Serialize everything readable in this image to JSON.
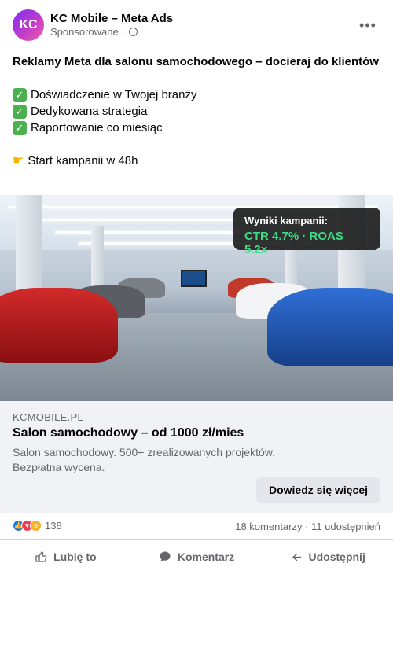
{
  "post": {
    "avatar_initials": "KC",
    "page_name": "KC Mobile – Meta Ads",
    "sponsored": "Sponsorowane ·",
    "more_icon": "ellipsis-icon",
    "title": "Reklamy Meta dla salonu samochodowego – docieraj do klientów",
    "bullets": [
      "Doświadczenie w Twojej branży",
      "Dedykowana strategia",
      "Raportowanie co miesiąc"
    ],
    "cta_line": "Start kampanii w 48h"
  },
  "hero": {
    "results_label": "Wyniki kampanii:",
    "results_value": "CTR 4.7% · ROAS 5.2x"
  },
  "link_card": {
    "domain": "KCMOBILE.PL",
    "headline": "Salon samochodowy – od 1000 zł/mies",
    "description": "Salon samochodowy. 500+ zrealizowanych projektów. Bezpłatna wycena.",
    "button_label": "Dowiedz się więcej"
  },
  "stats": {
    "reaction_count": "138",
    "counts": "18 komentarzy · 11 udostępnień"
  },
  "actions": {
    "like": "Lubię to",
    "comment": "Komentarz",
    "share": "Udostępnij"
  },
  "colors": {
    "accent_green": "#3ddc84",
    "like_blue": "#1877f2",
    "card_bg": "#f0f2f5"
  }
}
